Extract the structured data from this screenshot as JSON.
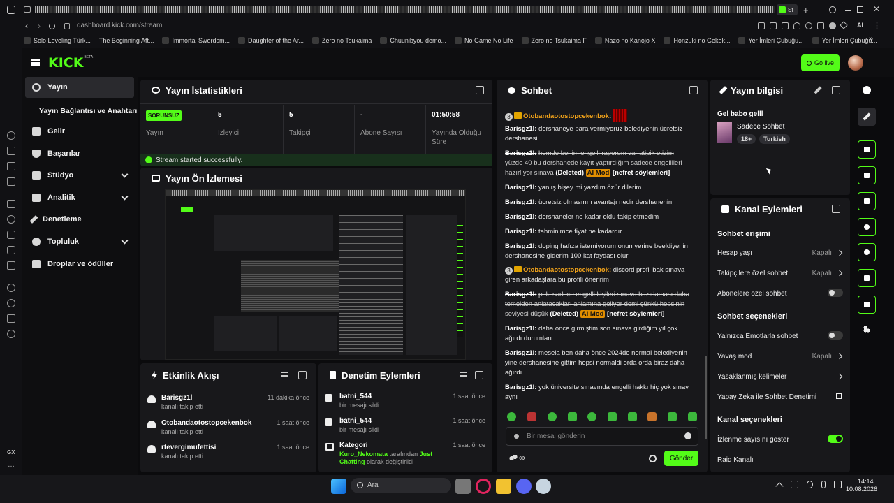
{
  "browser": {
    "url": "dashboard.kick.com/stream",
    "active_tab": "St",
    "ai_label": "AI",
    "bookmarks": [
      "Solo Leveling Türk...",
      "The Beginning Aft...",
      "Immortal Swordsm...",
      "Daughter of the Ar...",
      "Zero no Tsukaima",
      "Chuunibyou demo...",
      "No Game No Life",
      "Zero no Tsukaima F",
      "Nazo no Kanojo X",
      "Honzuki no Gekok...",
      "Yer İmleri Çubuğu...",
      "Yer İmleri Çubuğu..."
    ]
  },
  "rail": {
    "gx": "GX"
  },
  "topbar": {
    "logo": "KICK",
    "logo_sup": "BETA",
    "go_live": "Go live"
  },
  "sidebar": {
    "items": [
      {
        "label": "Yayın",
        "icon": "broadcast-icon"
      },
      {
        "label": "Yayın Bağlantısı ve Anahtarı"
      },
      {
        "label": "Gelir",
        "icon": "chart-icon"
      },
      {
        "label": "Başarılar",
        "icon": "trophy-icon"
      },
      {
        "label": "Stüdyo",
        "icon": "studio-icon"
      },
      {
        "label": "Analitik",
        "icon": "analytics-icon"
      },
      {
        "label": "Denetleme",
        "icon": "wrench-icon"
      },
      {
        "label": "Topluluk",
        "icon": "community-icon"
      },
      {
        "label": "Droplar ve ödüller",
        "icon": "drops-icon"
      }
    ]
  },
  "stats": {
    "title": "Yayın İstatistikleri",
    "status_badge": "SORUNSUZ",
    "items": [
      {
        "value": "",
        "label": "Yayın"
      },
      {
        "value": "5",
        "label": "İzleyici"
      },
      {
        "value": "5",
        "label": "Takipçi"
      },
      {
        "value": "-",
        "label": "Abone Sayısı"
      },
      {
        "value": "01:50:58",
        "label": "Yayında Olduğu Süre"
      }
    ],
    "success_msg": "Stream started successfully."
  },
  "preview": {
    "title": "Yayın Ön İzlemesi"
  },
  "activity": {
    "title": "Etkinlik Akışı",
    "items": [
      {
        "user": "Barisgz1l",
        "desc": "kanalı takip etti",
        "time": "11 dakika önce"
      },
      {
        "user": "Otobandaotostopcekenbok",
        "desc": "kanalı takip etti",
        "time": "1 saat önce"
      },
      {
        "user": "rtevergimufettisi",
        "desc": "kanalı takip etti",
        "time": "1 saat önce"
      }
    ]
  },
  "moderation": {
    "title": "Denetim Eylemleri",
    "items": [
      {
        "user": "batni_544",
        "desc": "bir mesajı sildi",
        "time": "1 saat önce"
      },
      {
        "user": "batni_544",
        "desc": "bir mesajı sildi",
        "time": "1 saat önce"
      }
    ],
    "category": {
      "title": "Kategori",
      "user": "Kuro_Nekomata",
      "mid": "tarafından",
      "cat": "Just Chatting",
      "tail1": "olarak",
      "tail2": "değiştirildi",
      "time": "1 saat önce"
    }
  },
  "chat": {
    "title": "Sohbet",
    "messages": [
      {
        "badge": "3",
        "user": "Otobandaotostopcekenbok",
        "text": ""
      },
      {
        "user": "Barisgz1l:",
        "text": "dershaneye para vermiyoruz belediyenin ücretsiz dershanesi"
      },
      {
        "user": "Barisgz1l:",
        "text": "hemde benim engelli raporum var atipik otizim yüzde 40 bu dershanede kayıt yaptırdığım sadece engellileri hazırlıyor sınava",
        "deleted": "(Deleted)",
        "tag": "AI Mod",
        "reason": "[nefret söylemleri]"
      },
      {
        "user": "Barisgz1l:",
        "text": "yanlış bişey mi yazdım özür dilerim"
      },
      {
        "user": "Barisgz1l:",
        "text": "ücretsiz olmasının avantajı nedir dershanenin"
      },
      {
        "user": "Barisgz1l:",
        "text": "dershaneler ne kadar oldu takip etmedim"
      },
      {
        "user": "Barisgz1l:",
        "text": "tahminimce fiyat ne kadardır"
      },
      {
        "user": "Barisgz1l:",
        "text": "doping hafıza istemiyorum onun yerine beeldiyenin dershanesine giderim 100 kat faydası olur"
      },
      {
        "badge": "3",
        "user": "Otobandaotostopcekenbok:",
        "text": "discord profil bak sınava giren arkadaşlara bu profili öneririm"
      },
      {
        "user": "Barisgz1l:",
        "text": "peki sadece engelli kişileri sınava hazırlaması daha temelden anlatacakları anlamına geliyor demi çünkü hepsinin seviyesi düşük",
        "deleted": "(Deleted)",
        "tag": "AI Mod",
        "reason": "[nefret söylemleri]"
      },
      {
        "user": "Barisgz1l:",
        "text": "daha once girmiştim son sınava girdiğim yıl çok ağırdı durumları"
      },
      {
        "user": "Barisgz1l:",
        "text": "mesela ben daha önce 2024de normal belediyenin yine dershanesine gittim hepsi normaldi orda orda biraz daha ağırdı"
      },
      {
        "user": "Barisgz1l:",
        "text": "yok üniversite sınavında engelli hakkı hiç yok sınav aynı"
      }
    ],
    "placeholder": "Bir mesaj gönderin",
    "send": "Gönder"
  },
  "stream_info": {
    "title": "Yayın bilgisi",
    "stream_title": "Gel babo gelll",
    "category": "Sadece Sohbet",
    "tags": [
      "18+",
      "Turkish"
    ]
  },
  "channel_actions": {
    "title": "Kanal Eylemleri",
    "chat_access": "Sohbet erişimi",
    "account_age": {
      "label": "Hesap yaşı",
      "value": "Kapalı"
    },
    "followers_only": {
      "label": "Takipçilere özel sohbet",
      "value": "Kapalı"
    },
    "subs_only": {
      "label": "Abonelere özel sohbet",
      "on": false
    },
    "chat_options": "Sohbet seçenekleri",
    "emote_only": {
      "label": "Yalnızca Emotlarla sohbet",
      "on": false
    },
    "slow_mode": {
      "label": "Yavaş mod",
      "value": "Kapalı"
    },
    "banned_words": "Yasaklanmış kelimeler",
    "ai_moderation": "Yapay Zeka ile Sohbet Denetimi",
    "channel_options": "Kanal seçenekleri",
    "show_viewers": {
      "label": "İzlenme sayısını göster",
      "on": true
    },
    "raid": "Raid Kanalı"
  },
  "taskbar": {
    "search": "Ara",
    "time": "14:14",
    "date": "10.08.2026"
  },
  "colors": {
    "accent": "#53fc18",
    "panel": "#18181b",
    "bg": "#0b0b0d"
  }
}
